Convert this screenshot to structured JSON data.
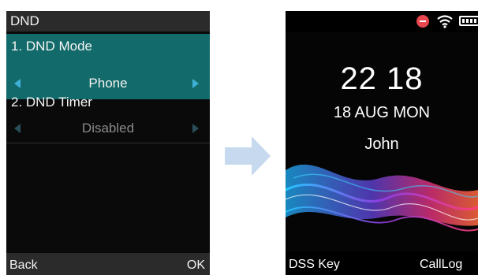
{
  "left_screen": {
    "title": "DND",
    "items": [
      {
        "label": "1. DND Mode",
        "value": "Phone",
        "selected": true
      },
      {
        "label": "2. DND Timer",
        "value": "Disabled",
        "selected": false
      }
    ],
    "softkeys": {
      "left": "Back",
      "right": "OK"
    },
    "colors": {
      "highlight": "#136a6a",
      "arrow": "#3fb0d6"
    }
  },
  "transition_arrow": {
    "color": "#c7d9ee",
    "icon": "arrow-right-icon"
  },
  "right_screen": {
    "status_icons": [
      "dnd-icon",
      "wifi-icon",
      "battery-icon"
    ],
    "time": "22 18",
    "date": "18 AUG MON",
    "name": "John",
    "softkeys": {
      "left": "DSS Key",
      "right": "CallLog"
    },
    "colors": {
      "dnd": "#e8474f"
    }
  }
}
